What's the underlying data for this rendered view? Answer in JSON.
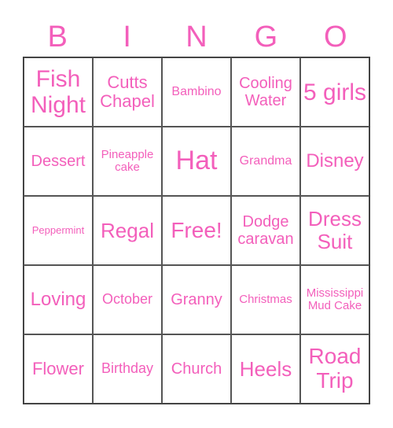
{
  "header": {
    "letters": [
      "B",
      "I",
      "N",
      "G",
      "O"
    ]
  },
  "accent_color": "#f35fbb",
  "cells": [
    [
      "Fish Night",
      "Cutts Chapel",
      "Bambino",
      "Cooling Water",
      "5 girls"
    ],
    [
      "Dessert",
      "Pineapple cake",
      "Hat",
      "Grandma",
      "Disney"
    ],
    [
      "Peppermint",
      "Regal",
      "Free!",
      "Dodge caravan",
      "Dress Suit"
    ],
    [
      "Loving",
      "October",
      "Granny",
      "Christmas",
      "Mississippi Mud Cake"
    ],
    [
      "Flower",
      "Birthday",
      "Church",
      "Heels",
      "Road Trip"
    ]
  ]
}
